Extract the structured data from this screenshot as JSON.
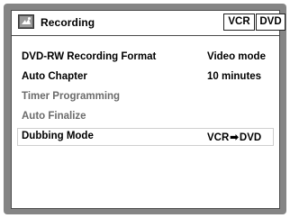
{
  "header": {
    "title": "Recording",
    "icon": "recording-menu-icon",
    "badges": [
      "VCR",
      "DVD"
    ]
  },
  "menu": {
    "items": [
      {
        "label": "DVD-RW Recording Format",
        "value": "Video mode"
      },
      {
        "label": "Auto Chapter",
        "value": "10 minutes"
      },
      {
        "label": "Timer Programming",
        "value": ""
      },
      {
        "label": "Auto Finalize",
        "value": ""
      },
      {
        "label": "Dubbing Mode",
        "value_from": "VCR",
        "value_arrow": "➡",
        "value_to": "DVD"
      }
    ],
    "selected_index": 4
  },
  "colors": {
    "bezel": "#858585",
    "text_active": "#000000",
    "text_inactive": "#6b6b6b"
  }
}
